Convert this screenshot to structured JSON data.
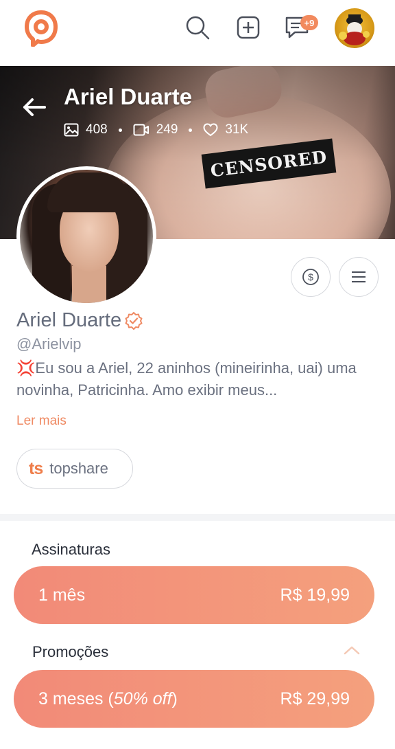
{
  "nav": {
    "logo_icon": "logo-icon",
    "search_icon": "search-icon",
    "add_icon": "add-icon",
    "chat_icon": "chat-icon",
    "chat_badge": "+9",
    "avatar_icon": "avatar"
  },
  "cover": {
    "title": "Ariel Duarte",
    "censored_label": "CENSORED",
    "stats": {
      "photos": "408",
      "videos": "249",
      "likes": "31K"
    }
  },
  "profile": {
    "name": "Ariel Duarte",
    "handle": "@Arielvip",
    "bio_emoji": "💢",
    "bio_text": "Eu sou a Ariel, 22 aninhos (mineirinha, uai) uma novinha, Patricinha. Amo exibir meus...",
    "read_more": "Ler mais",
    "link_chip": {
      "logo": "ts",
      "label": "topshare"
    }
  },
  "subscriptions": {
    "label": "Assinaturas",
    "plans": [
      {
        "duration": "1 mês",
        "price": "R$ 19,99"
      }
    ]
  },
  "promotions": {
    "label": "Promoções",
    "plans": [
      {
        "duration": "3 meses",
        "discount": "50% off",
        "price": "R$ 29,99"
      }
    ]
  },
  "colors": {
    "accent": "#f28a5e",
    "plan_gradient_start": "#f28a78",
    "plan_gradient_end": "#f4a07d"
  }
}
